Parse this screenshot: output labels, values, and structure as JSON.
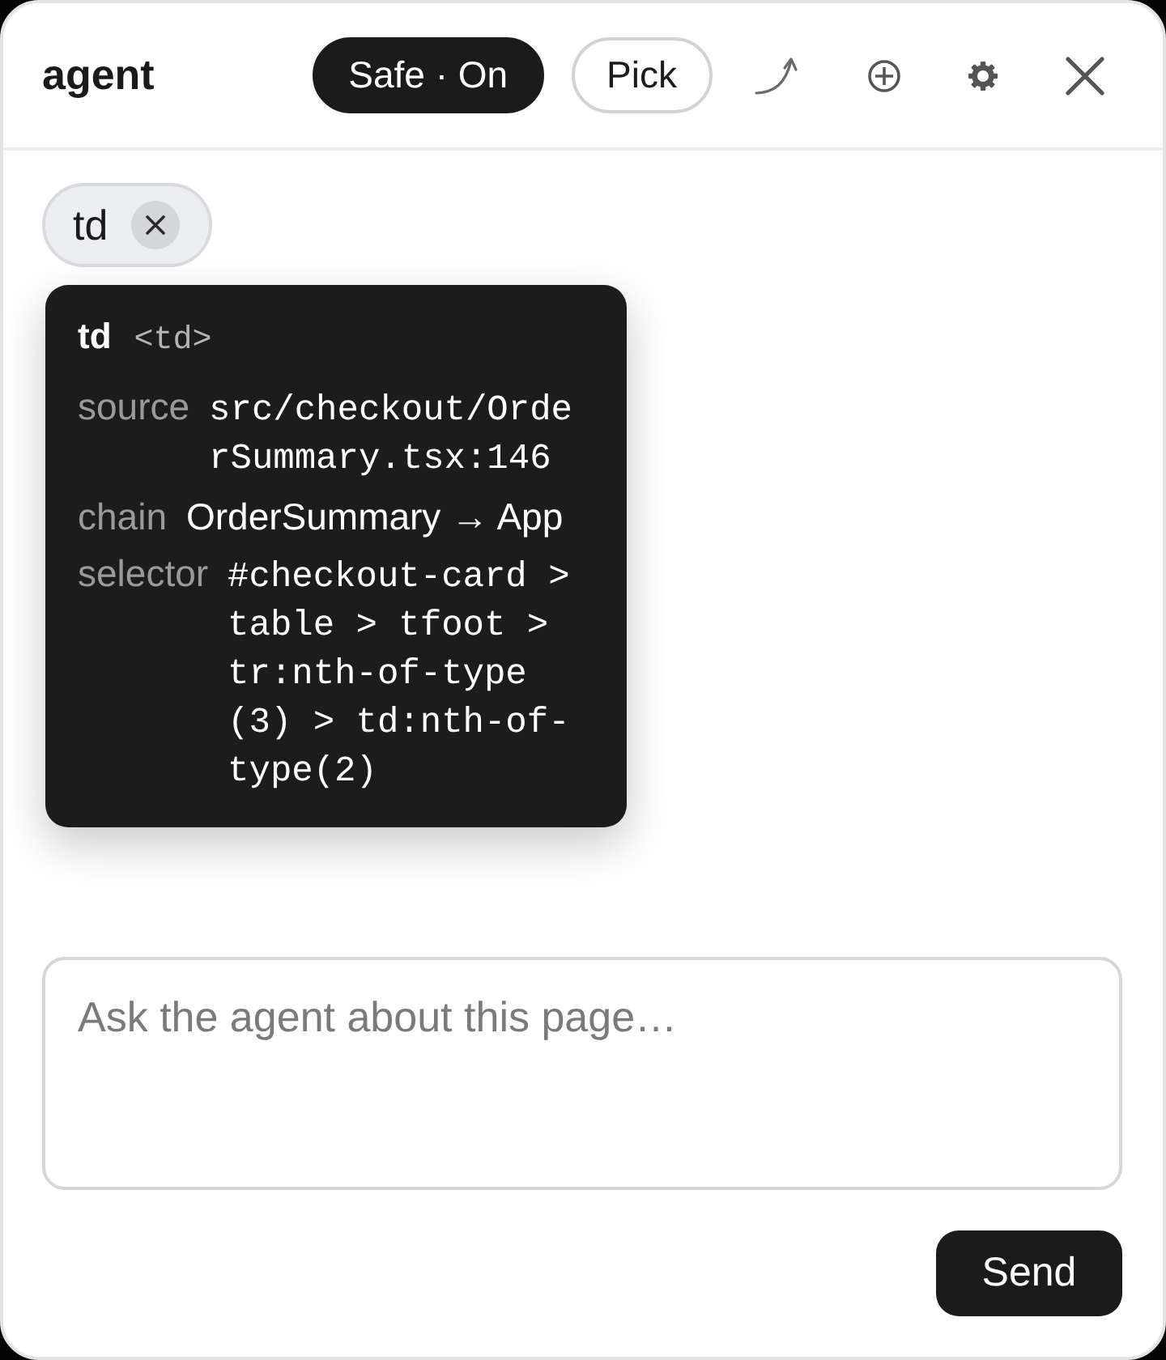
{
  "header": {
    "title": "agent",
    "toggles": [
      {
        "label": "Safe · On",
        "on": true
      },
      {
        "label": "Pick",
        "on": false
      }
    ]
  },
  "chips": [
    {
      "label": "td"
    }
  ],
  "inspector": {
    "tag": "td",
    "element": "<td>",
    "rows": [
      {
        "label": "source",
        "value": "src/checkout/OrderSummary.tsx:146",
        "kind": "code"
      },
      {
        "label": "chain",
        "value": "OrderSummary → App",
        "kind": "text"
      },
      {
        "label": "selector",
        "value": "#checkout-card > table > tfoot > tr:nth-of-type(3) > td:nth-of-type(2)",
        "kind": "code"
      }
    ]
  },
  "composer": {
    "placeholder": "Ask the agent about this page…",
    "send": "Send"
  }
}
